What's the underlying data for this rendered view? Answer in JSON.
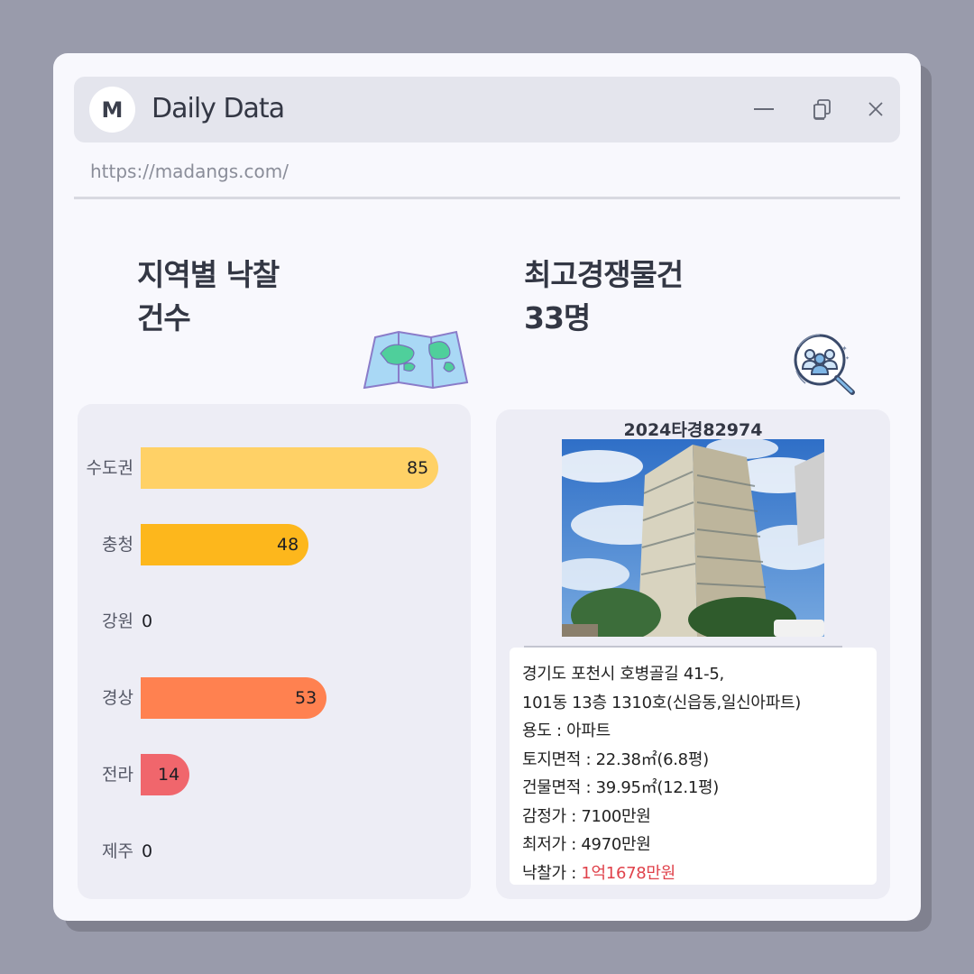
{
  "window": {
    "logo_letter": "M",
    "title": "Daily Data",
    "url": "https://madangs.com/"
  },
  "icons": [
    "minimize-icon",
    "restore-icon",
    "close-icon",
    "map-icon",
    "people-search-icon"
  ],
  "left": {
    "heading_line1": "지역별 낙찰",
    "heading_line2": "건수",
    "chart_data": {
      "type": "bar",
      "orientation": "horizontal",
      "categories": [
        "수도권",
        "충청",
        "강원",
        "경상",
        "전라",
        "제주"
      ],
      "values": [
        85,
        48,
        0,
        53,
        14,
        0
      ],
      "colors": [
        "#ffd166",
        "#fdb71c",
        "#fdb71c",
        "#ff8150",
        "#f0666c",
        "#f0666c"
      ],
      "xlim": [
        0,
        85
      ]
    }
  },
  "right": {
    "heading_line1": "최고경쟁물건",
    "heading_line2": "33명",
    "case_number": "2024타경82974",
    "address_line1": "경기도 포천시 호병골길 41-5,",
    "address_line2": "101동 13층 1310호(신읍동,일신아파트)",
    "usage": "용도 : 아파트",
    "land_area": "토지면적 : 22.38㎡(6.8평)",
    "building_area": "건물면적 : 39.95㎡(12.1평)",
    "appraisal": "감정가 : 7100만원",
    "minimum": "최저가 : 4970만원",
    "winning_label": "낙찰가 : ",
    "winning_price": "1억1678만원"
  }
}
